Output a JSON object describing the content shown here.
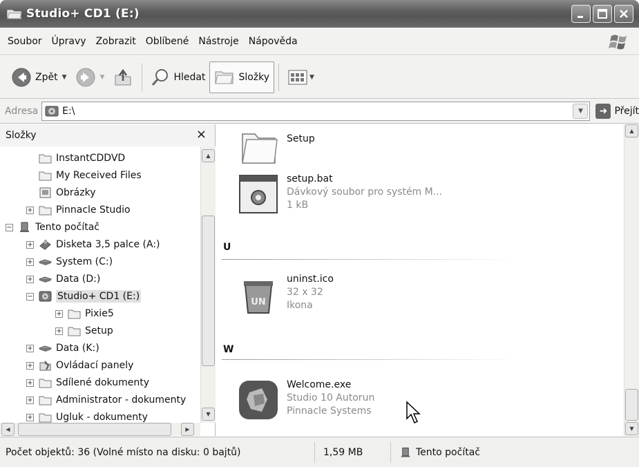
{
  "window": {
    "title": "Studio+ CD1 (E:)"
  },
  "menu": [
    "Soubor",
    "Úpravy",
    "Zobrazit",
    "Oblíbené",
    "Nástroje",
    "Nápověda"
  ],
  "toolbar": {
    "back_label": "Zpět",
    "search_label": "Hledat",
    "folders_label": "Složky"
  },
  "address": {
    "label": "Adresa",
    "value": "E:\\",
    "go_label": "Přejít"
  },
  "folders_pane": {
    "title": "Složky",
    "close_glyph": "×",
    "items": [
      {
        "label": "InstantCDDVD",
        "icon": "folder-icon"
      },
      {
        "label": "My Received Files",
        "icon": "folder-icon"
      },
      {
        "label": "Obrázky",
        "icon": "pictures-folder-icon"
      },
      {
        "label": "Pinnacle Studio",
        "icon": "folder-icon"
      },
      {
        "label": "Tento počítač",
        "icon": "computer-icon"
      },
      {
        "label": "Disketa 3,5 palce (A:)",
        "icon": "floppy-icon"
      },
      {
        "label": "System (C:)",
        "icon": "drive-icon"
      },
      {
        "label": "Data (D:)",
        "icon": "drive-icon"
      },
      {
        "label": "Studio+ CD1 (E:)",
        "icon": "cd-drive-icon"
      },
      {
        "label": "Pixie5",
        "icon": "folder-icon"
      },
      {
        "label": "Setup",
        "icon": "folder-icon"
      },
      {
        "label": "Data (K:)",
        "icon": "drive-icon"
      },
      {
        "label": "Ovládací panely",
        "icon": "control-panel-icon"
      },
      {
        "label": "Sdílené dokumenty",
        "icon": "folder-icon"
      },
      {
        "label": "Administrator - dokumenty",
        "icon": "folder-icon"
      },
      {
        "label": "Ugluk - dokumenty",
        "icon": "folder-icon"
      }
    ]
  },
  "content": {
    "items": [
      {
        "name": "Setup",
        "icon": "folder-icon"
      },
      {
        "name": "setup.bat",
        "line2": "Dávkový soubor pro systém M...",
        "line3": "1 kB",
        "icon": "batch-file-icon"
      },
      {
        "name": "uninst.ico",
        "line2": "32 x 32",
        "line3": "Ikona",
        "icon": "uninstall-icon"
      },
      {
        "name": "Welcome.exe",
        "line2": "Studio 10 Autorun",
        "line3": "Pinnacle Systems",
        "icon": "autorun-icon"
      }
    ],
    "groups": [
      "U",
      "W"
    ]
  },
  "status": {
    "objects": "Počet objektů: 36 (Volné místo na disku: 0 bajtů)",
    "size": "1,59 MB",
    "location": "Tento počítač"
  }
}
